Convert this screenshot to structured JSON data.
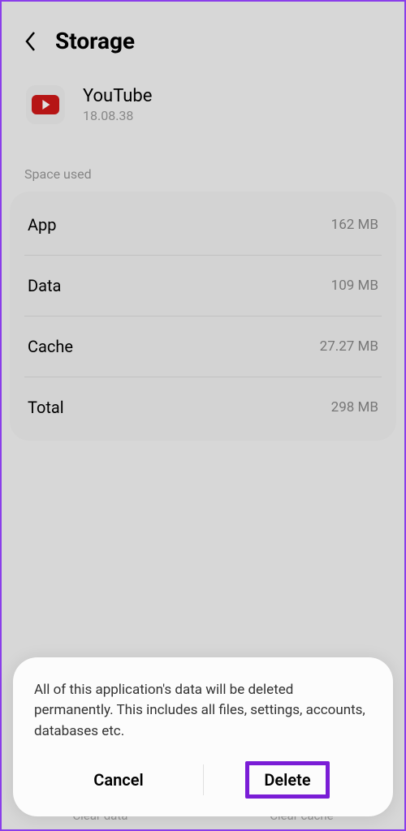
{
  "header": {
    "title": "Storage"
  },
  "app": {
    "name": "YouTube",
    "version": "18.08.38"
  },
  "section": {
    "space_used_label": "Space used"
  },
  "storage": {
    "rows": [
      {
        "label": "App",
        "value": "162 MB"
      },
      {
        "label": "Data",
        "value": "109 MB"
      },
      {
        "label": "Cache",
        "value": "27.27 MB"
      },
      {
        "label": "Total",
        "value": "298 MB"
      }
    ]
  },
  "dialog": {
    "message": "All of this application's data will be deleted permanently. This includes all files, settings, accounts, databases etc.",
    "cancel_label": "Cancel",
    "delete_label": "Delete"
  },
  "bottom_hints": {
    "clear_data": "Clear data",
    "clear_cache": "Clear cache"
  }
}
